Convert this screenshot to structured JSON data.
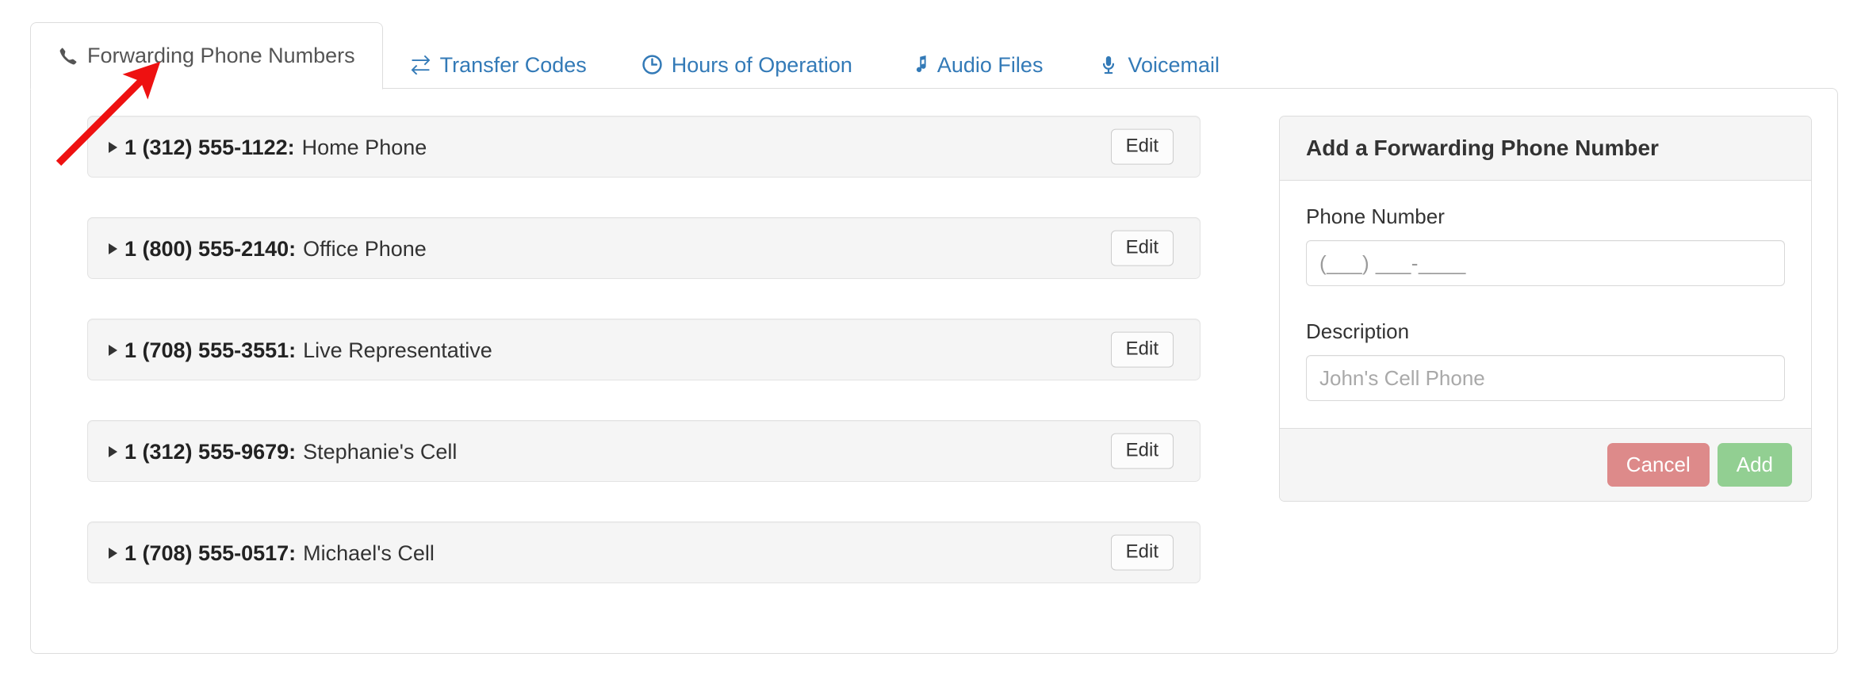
{
  "tabs": [
    {
      "label": "Forwarding Phone Numbers",
      "icon": "phone-icon",
      "active": true
    },
    {
      "label": "Transfer Codes",
      "icon": "transfer-arrows-icon",
      "active": false
    },
    {
      "label": "Hours of Operation",
      "icon": "clock-icon",
      "active": false
    },
    {
      "label": "Audio Files",
      "icon": "music-note-icon",
      "active": false
    },
    {
      "label": "Voicemail",
      "icon": "microphone-icon",
      "active": false
    }
  ],
  "forwarding_numbers": [
    {
      "number": "1 (312) 555-1122:",
      "description": "Home Phone",
      "edit_label": "Edit"
    },
    {
      "number": "1 (800) 555-2140:",
      "description": "Office Phone",
      "edit_label": "Edit"
    },
    {
      "number": "1 (708) 555-3551:",
      "description": "Live Representative",
      "edit_label": "Edit"
    },
    {
      "number": "1 (312) 555-9679:",
      "description": "Stephanie's Cell",
      "edit_label": "Edit"
    },
    {
      "number": "1 (708) 555-0517:",
      "description": "Michael's Cell",
      "edit_label": "Edit"
    }
  ],
  "add_form": {
    "title": "Add a Forwarding Phone Number",
    "phone_label": "Phone Number",
    "phone_value": "(___) ___-____",
    "phone_placeholder": "(___) ___-____",
    "description_label": "Description",
    "description_value": "",
    "description_placeholder": "John's Cell Phone",
    "cancel_label": "Cancel",
    "add_label": "Add"
  },
  "annotation": {
    "type": "arrow",
    "color": "#ee1111",
    "points_to": "Forwarding Phone Numbers tab"
  },
  "colors": {
    "link_blue": "#337ab7",
    "active_tab_text": "#555555",
    "row_background": "#f5f5f5",
    "cancel_red": "#dd8a8a",
    "add_green": "#92cf92",
    "annotation_red": "#ee1111"
  }
}
